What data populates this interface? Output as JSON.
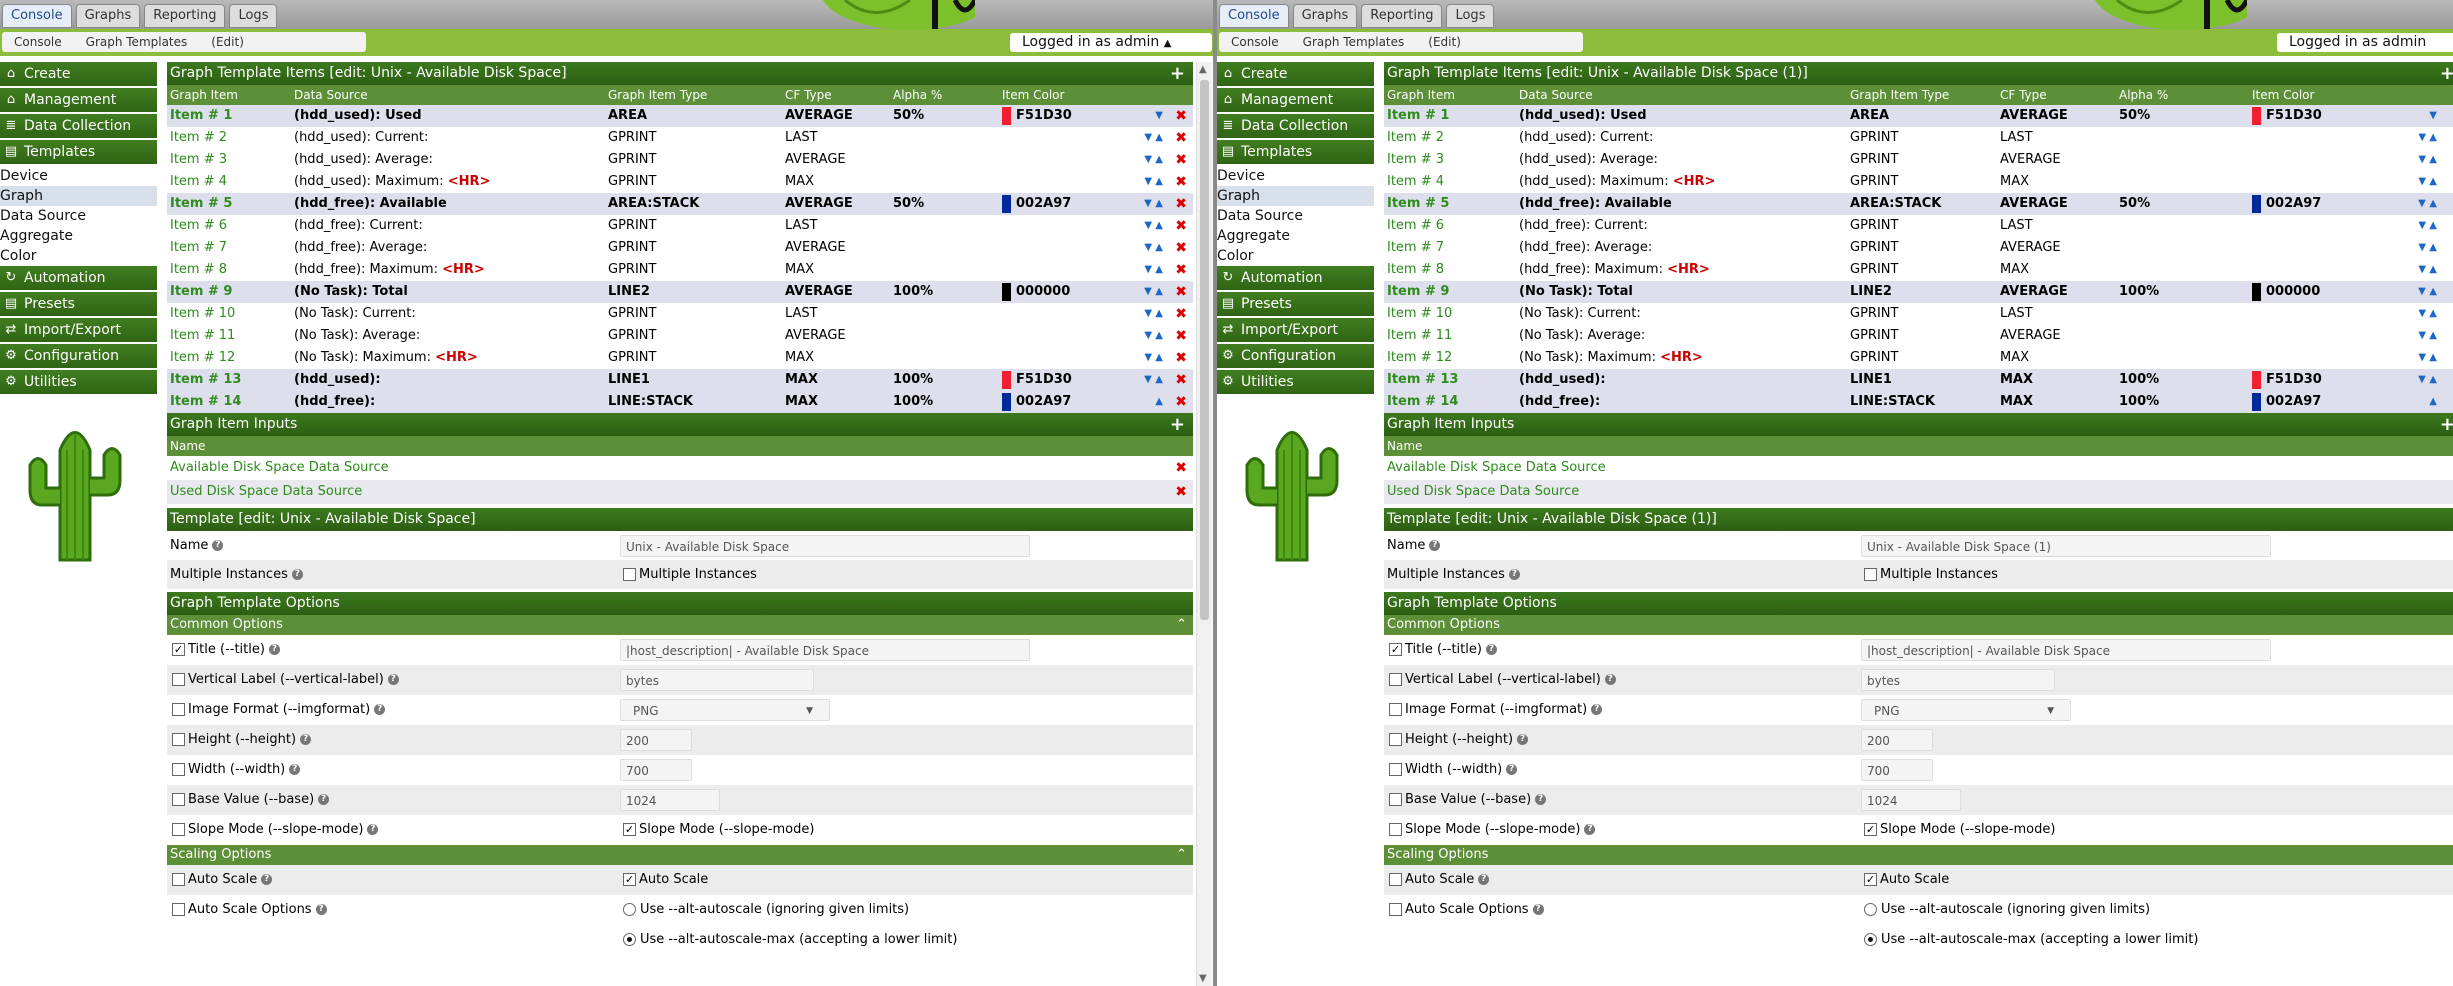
{
  "topbar": {
    "tabs": [
      "Console",
      "Graphs",
      "Reporting",
      "Logs"
    ],
    "active": "Console"
  },
  "crumbs": [
    "Console",
    "Graph Templates",
    "(Edit)"
  ],
  "login": "Logged in as admin",
  "sidebar": {
    "groups": [
      {
        "label": "Create",
        "icon": "create-icon",
        "glyph": "⌂"
      },
      {
        "label": "Management",
        "icon": "home-icon",
        "glyph": "⌂"
      },
      {
        "label": "Data Collection",
        "icon": "database-icon",
        "glyph": "≣"
      },
      {
        "label": "Templates",
        "icon": "template-icon",
        "glyph": "▤"
      }
    ],
    "template_items": [
      "Device",
      "Graph",
      "Data Source",
      "Aggregate",
      "Color"
    ],
    "groups2": [
      {
        "label": "Automation",
        "icon": "automation-icon",
        "glyph": "↻"
      },
      {
        "label": "Presets",
        "icon": "presets-icon",
        "glyph": "▤"
      },
      {
        "label": "Import/Export",
        "icon": "import-export-icon",
        "glyph": "⇄"
      },
      {
        "label": "Configuration",
        "icon": "configuration-icon",
        "glyph": "⚙"
      },
      {
        "label": "Utilities",
        "icon": "utilities-icon",
        "glyph": "⚙"
      }
    ]
  },
  "items_header": {
    "left": "Graph Template Items [edit: Unix - Available Disk Space]",
    "right": "Graph Template Items [edit: Unix - Available Disk Space (1)]"
  },
  "columns": [
    "Graph Item",
    "Data Source",
    "Graph Item Type",
    "CF Type",
    "Alpha %",
    "Item Color"
  ],
  "items": [
    {
      "item": "Item # 1",
      "ds": "(hdd_used): Used",
      "hr": "",
      "type": "AREA",
      "cf": "AVERAGE",
      "alpha": "50%",
      "color": "F51D30",
      "hex": "#F51D30",
      "hl": true,
      "bold": true,
      "up": false,
      "down": true
    },
    {
      "item": "Item # 2",
      "ds": "(hdd_used): Current:",
      "hr": "",
      "type": "GPRINT",
      "cf": "LAST",
      "alpha": "",
      "color": "",
      "hex": "",
      "hl": false,
      "bold": false,
      "up": true,
      "down": true
    },
    {
      "item": "Item # 3",
      "ds": "(hdd_used): Average:",
      "hr": "",
      "type": "GPRINT",
      "cf": "AVERAGE",
      "alpha": "",
      "color": "",
      "hex": "",
      "hl": false,
      "bold": false,
      "up": true,
      "down": true
    },
    {
      "item": "Item # 4",
      "ds": "(hdd_used): Maximum:",
      "hr": "<HR>",
      "type": "GPRINT",
      "cf": "MAX",
      "alpha": "",
      "color": "",
      "hex": "",
      "hl": false,
      "bold": false,
      "up": true,
      "down": true
    },
    {
      "item": "Item # 5",
      "ds": "(hdd_free): Available",
      "hr": "",
      "type": "AREA:STACK",
      "cf": "AVERAGE",
      "alpha": "50%",
      "color": "002A97",
      "hex": "#002A97",
      "hl": true,
      "bold": true,
      "up": true,
      "down": true
    },
    {
      "item": "Item # 6",
      "ds": "(hdd_free): Current:",
      "hr": "",
      "type": "GPRINT",
      "cf": "LAST",
      "alpha": "",
      "color": "",
      "hex": "",
      "hl": false,
      "bold": false,
      "up": true,
      "down": true
    },
    {
      "item": "Item # 7",
      "ds": "(hdd_free): Average:",
      "hr": "",
      "type": "GPRINT",
      "cf": "AVERAGE",
      "alpha": "",
      "color": "",
      "hex": "",
      "hl": false,
      "bold": false,
      "up": true,
      "down": true
    },
    {
      "item": "Item # 8",
      "ds": "(hdd_free): Maximum:",
      "hr": "<HR>",
      "type": "GPRINT",
      "cf": "MAX",
      "alpha": "",
      "color": "",
      "hex": "",
      "hl": false,
      "bold": false,
      "up": true,
      "down": true
    },
    {
      "item": "Item # 9",
      "ds": "(No Task): Total",
      "hr": "",
      "type": "LINE2",
      "cf": "AVERAGE",
      "alpha": "100%",
      "color": "000000",
      "hex": "#000000",
      "hl": true,
      "bold": true,
      "up": true,
      "down": true
    },
    {
      "item": "Item # 10",
      "ds": "(No Task): Current:",
      "hr": "",
      "type": "GPRINT",
      "cf": "LAST",
      "alpha": "",
      "color": "",
      "hex": "",
      "hl": false,
      "bold": false,
      "up": true,
      "down": true
    },
    {
      "item": "Item # 11",
      "ds": "(No Task): Average:",
      "hr": "",
      "type": "GPRINT",
      "cf": "AVERAGE",
      "alpha": "",
      "color": "",
      "hex": "",
      "hl": false,
      "bold": false,
      "up": true,
      "down": true
    },
    {
      "item": "Item # 12",
      "ds": "(No Task): Maximum:",
      "hr": "<HR>",
      "type": "GPRINT",
      "cf": "MAX",
      "alpha": "",
      "color": "",
      "hex": "",
      "hl": false,
      "bold": false,
      "up": true,
      "down": true
    },
    {
      "item": "Item # 13",
      "ds": "(hdd_used):",
      "hr": "",
      "type": "LINE1",
      "cf": "MAX",
      "alpha": "100%",
      "color": "F51D30",
      "hex": "#F51D30",
      "hl": true,
      "bold": true,
      "up": true,
      "down": true
    },
    {
      "item": "Item # 14",
      "ds": "(hdd_free):",
      "hr": "",
      "type": "LINE:STACK",
      "cf": "MAX",
      "alpha": "100%",
      "color": "002A97",
      "hex": "#002A97",
      "hl": true,
      "bold": true,
      "up": true,
      "down": false
    }
  ],
  "inputs": {
    "title": "Graph Item Inputs",
    "col": "Name",
    "rows": [
      "Available Disk Space Data Source",
      "Used Disk Space Data Source"
    ]
  },
  "template": {
    "header_left": "Template [edit: Unix - Available Disk Space]",
    "header_right": "Template [edit: Unix - Available Disk Space (1)]",
    "name_label": "Name",
    "name_left": "Unix - Available Disk Space",
    "name_right": "Unix - Available Disk Space (1)",
    "multi_label": "Multiple Instances",
    "multi_cb": "Multiple Instances"
  },
  "options": {
    "header": "Graph Template Options",
    "common": "Common Options",
    "title_label": "Title (--title)",
    "title_value": "|host_description| - Available Disk Space",
    "vlabel": "Vertical Label (--vertical-label)",
    "vlabel_value": "bytes",
    "imgformat": "Image Format (--imgformat)",
    "imgformat_value": "PNG",
    "height": "Height (--height)",
    "height_value": "200",
    "width": "Width (--width)",
    "width_value": "700",
    "base": "Base Value (--base)",
    "base_value": "1024",
    "slope": "Slope Mode (--slope-mode)",
    "slope_cb": "Slope Mode (--slope-mode)",
    "scaling": "Scaling Options",
    "autoscale": "Auto Scale",
    "autoscale_cb": "Auto Scale",
    "autoscale_opts": "Auto Scale Options",
    "radio1": "Use --alt-autoscale (ignoring given limits)",
    "radio2": "Use --alt-autoscale-max (accepting a lower limit)"
  }
}
